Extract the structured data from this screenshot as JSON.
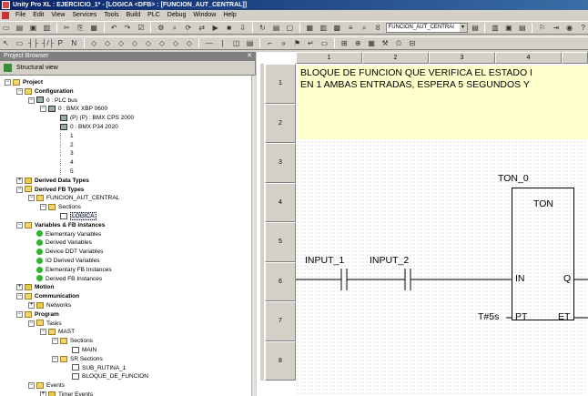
{
  "window": {
    "title": "Unity Pro XL : EJERCICIO_1* - [LOGICA <DFB> : [FUNCION_AUT_CENTRAL]]"
  },
  "menu": [
    "File",
    "Edit",
    "View",
    "Services",
    "Tools",
    "Build",
    "PLC",
    "Debug",
    "Window",
    "Help"
  ],
  "toolbar": {
    "combo_value": "FUNCION_AUT_CENTRAI"
  },
  "browser": {
    "header": "Project Browser",
    "view_label": "Structural view",
    "tree": [
      {
        "label": "Project",
        "bold": true,
        "icon": "folder-open",
        "indent": 0
      },
      {
        "label": "Configuration",
        "bold": true,
        "icon": "folder-open",
        "indent": 1
      },
      {
        "label": "0 : PLC bus",
        "bold": false,
        "icon": "bus",
        "indent": 2
      },
      {
        "label": "0 : BMX XBP 0600",
        "bold": false,
        "icon": "rack",
        "indent": 3
      },
      {
        "label": "(P) (P) : BMX CPS 2000",
        "bold": false,
        "icon": "module",
        "indent": 4
      },
      {
        "label": "0 : BMX P34 2020",
        "bold": false,
        "icon": "module",
        "indent": 4
      },
      {
        "label": "1",
        "bold": false,
        "icon": "slot",
        "indent": 4
      },
      {
        "label": "2",
        "bold": false,
        "icon": "slot",
        "indent": 4
      },
      {
        "label": "3",
        "bold": false,
        "icon": "slot",
        "indent": 4
      },
      {
        "label": "4",
        "bold": false,
        "icon": "slot",
        "indent": 4
      },
      {
        "label": "5",
        "bold": false,
        "icon": "slot",
        "indent": 4
      },
      {
        "label": "Derived Data Types",
        "bold": true,
        "icon": "folder",
        "indent": 1
      },
      {
        "label": "Derived FB Types",
        "bold": true,
        "icon": "folder-open",
        "indent": 1
      },
      {
        "label": "FUNCION_AUT_CENTRAL",
        "bold": false,
        "icon": "folder-open",
        "indent": 2
      },
      {
        "label": "Sections",
        "bold": false,
        "icon": "folder-open",
        "indent": 3
      },
      {
        "label": "LOGICA",
        "bold": false,
        "icon": "section",
        "indent": 4,
        "selected": true
      },
      {
        "label": "Variables & FB instances",
        "bold": true,
        "icon": "folder-open",
        "indent": 1
      },
      {
        "label": "Elementary Variables",
        "bold": false,
        "icon": "green",
        "indent": 2
      },
      {
        "label": "Derived Variables",
        "bold": false,
        "icon": "green",
        "indent": 2
      },
      {
        "label": "Device DDT Variables",
        "bold": false,
        "icon": "green",
        "indent": 2
      },
      {
        "label": "IO Derived Variables",
        "bold": false,
        "icon": "green",
        "indent": 2
      },
      {
        "label": "Elementary FB Instances",
        "bold": false,
        "icon": "green",
        "indent": 2
      },
      {
        "label": "Derived FB Instances",
        "bold": false,
        "icon": "green",
        "indent": 2
      },
      {
        "label": "Motion",
        "bold": true,
        "icon": "folder",
        "indent": 1
      },
      {
        "label": "Communication",
        "bold": true,
        "icon": "folder-open",
        "indent": 1
      },
      {
        "label": "Networks",
        "bold": false,
        "icon": "folder",
        "indent": 2
      },
      {
        "label": "Program",
        "bold": true,
        "icon": "folder-open",
        "indent": 1
      },
      {
        "label": "Tasks",
        "bold": false,
        "icon": "folder-open",
        "indent": 2
      },
      {
        "label": "MAST",
        "bold": false,
        "icon": "folder-open",
        "indent": 3
      },
      {
        "label": "Sections",
        "bold": false,
        "icon": "folder-open",
        "indent": 4
      },
      {
        "label": "MAIN",
        "bold": false,
        "icon": "section",
        "indent": 5
      },
      {
        "label": "SR Sections",
        "bold": false,
        "icon": "folder-open",
        "indent": 4
      },
      {
        "label": "SUB_RUTINA_1",
        "bold": false,
        "icon": "section",
        "indent": 5
      },
      {
        "label": "BLOQUE_DE_FUNCION",
        "bold": false,
        "icon": "section",
        "indent": 5
      },
      {
        "label": "Events",
        "bold": false,
        "icon": "folder-open",
        "indent": 2
      },
      {
        "label": "Timer Events",
        "bold": false,
        "icon": "folder",
        "indent": 3
      }
    ]
  },
  "editor": {
    "columns": [
      "1",
      "2",
      "3",
      "4"
    ],
    "rows": [
      "1",
      "2",
      "3",
      "4",
      "5",
      "6",
      "7",
      "8"
    ],
    "comment_lines": [
      "BLOQUE DE FUNCION QUE VERIFICA EL ESTADO I",
      "EN 1 AMBAS ENTRADAS, ESPERA 5 SEGUNDOS Y"
    ],
    "fb_instance": "TON_0",
    "fb_type": "TON",
    "contacts": [
      "INPUT_1",
      "INPUT_2"
    ],
    "pins": {
      "in": "IN",
      "q": "Q",
      "pt": "PT",
      "et": "ET"
    },
    "pt_value": "T#5s"
  }
}
